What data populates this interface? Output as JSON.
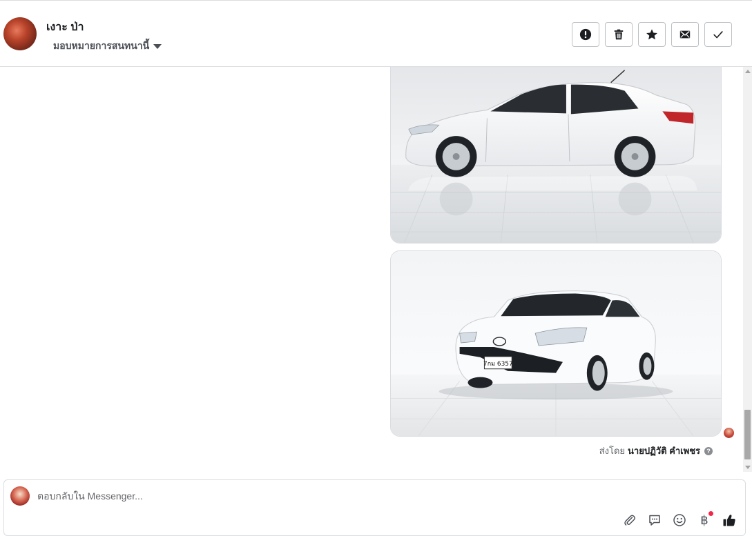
{
  "header": {
    "contact_name": "เงาะ ป่า",
    "assign_label": "มอบหมายการสนทนานี้"
  },
  "actions": [
    {
      "name": "report-button",
      "icon": "exclamation-icon"
    },
    {
      "name": "delete-button",
      "icon": "trash-icon"
    },
    {
      "name": "star-button",
      "icon": "star-icon"
    },
    {
      "name": "mark-unread-button",
      "icon": "envelope-icon"
    },
    {
      "name": "mark-done-button",
      "icon": "checkmark-icon"
    }
  ],
  "thread": {
    "photos": [
      {
        "alt": "white-sedan-side-view"
      },
      {
        "alt": "white-sedan-front-view",
        "plate": "7กม 6357"
      }
    ],
    "sent_by_label": "ส่งโดย",
    "sent_by_agent": "นายปฏิวัติ คำเพชร"
  },
  "composer": {
    "placeholder": "ตอบกลับใน Messenger...",
    "tools": [
      "paperclip-icon",
      "saved-reply-icon",
      "emoji-icon",
      "baht-icon",
      "thumbs-up-icon"
    ]
  },
  "colors": {
    "icon": "#4b4f56",
    "border": "#dadde1",
    "notification_dot": "#f02849"
  }
}
